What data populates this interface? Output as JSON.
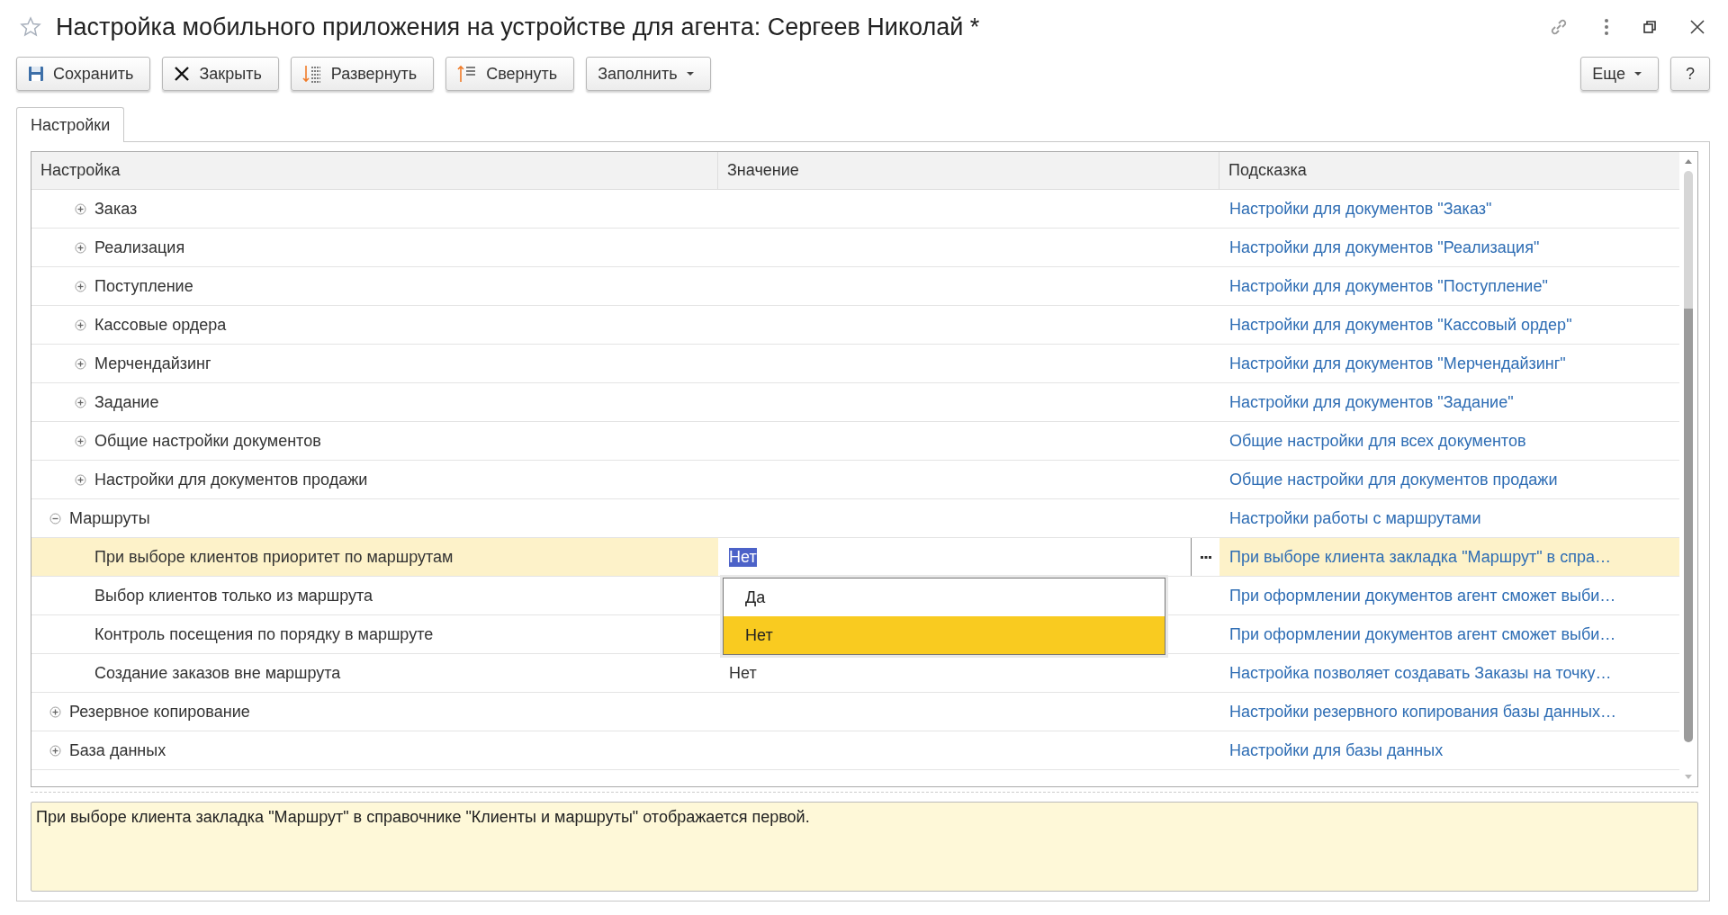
{
  "window": {
    "title": "Настройка мобильного приложения на устройстве для агента: Сергеев Николай *"
  },
  "toolbar": {
    "buttons": [
      {
        "label": "Сохранить",
        "kind": "save"
      },
      {
        "label": "Закрыть",
        "kind": "close"
      },
      {
        "label": "Развернуть",
        "kind": "expand"
      },
      {
        "label": "Свернуть",
        "kind": "collapse"
      },
      {
        "label": "Заполнить",
        "kind": "menu"
      }
    ],
    "right_buttons": [
      {
        "label": "Еще",
        "kind": "menu"
      },
      {
        "label": "?",
        "kind": "plain"
      }
    ]
  },
  "tabs": [
    {
      "label": "Настройки",
      "selected": true
    }
  ],
  "table": {
    "columns": [
      "Настройка",
      "Значение",
      "Подсказка"
    ],
    "rows": [
      {
        "children": [
          {
            "label": "Заказ",
            "expanded": false,
            "selected": false,
            "hint": "Настройки для документов \"Заказ\""
          },
          {
            "label": "Реализация",
            "expanded": false,
            "selected": false,
            "hint": "Настройки для документов \"Реализация\""
          },
          {
            "label": "Поступление",
            "expanded": false,
            "selected": false,
            "hint": "Настройки для документов \"Поступление\""
          },
          {
            "label": "Кассовые ордера",
            "expanded": false,
            "selected": false,
            "hint": "Настройки для документов \"Кассовый ордер\""
          },
          {
            "label": "Мерчендайзинг",
            "expanded": false,
            "selected": false,
            "hint": "Настройки для документов \"Мерчендайзинг\""
          },
          {
            "label": "Задание",
            "expanded": false,
            "selected": false,
            "hint": "Настройки для документов \"Задание\""
          },
          {
            "label": "Общие настройки документов",
            "expanded": false,
            "selected": false,
            "hint": "Общие настройки для всех документов"
          },
          {
            "label": "Настройки для документов продажи",
            "expanded": false,
            "selected": false,
            "hint": "Общие настройки для документов продажи"
          }
        ]
      },
      {
        "label": "Маршруты",
        "expanded": true,
        "selected": false,
        "hint": "Настройки работы с маршрутами",
        "children": [
          {
            "label": "При выборе клиентов приоритет по маршрутам",
            "value": "Нет",
            "selected": true,
            "editing": true,
            "hint": "При выборе клиента закладка \"Маршрут\" в спра…",
            "options": [
              {
                "label": "Да",
                "selected": false
              },
              {
                "label": "Нет",
                "selected": true
              }
            ]
          },
          {
            "label": "Выбор клиентов только из маршрута",
            "selected": false,
            "hint": "При оформлении документов агент сможет выби…"
          },
          {
            "label": "Контроль посещения по порядку в маршруте",
            "selected": false,
            "hint": "При оформлении документов агент сможет выби…"
          },
          {
            "label": "Создание заказов вне маршрута",
            "value": "Нет",
            "selected": false,
            "hint": "Настройка позволяет создавать Заказы на точку…"
          }
        ]
      },
      {
        "label": "Резервное копирование",
        "expanded": false,
        "selected": false,
        "hint": "Настройки резервного копирования базы данных…"
      },
      {
        "label": "База данных",
        "expanded": false,
        "selected": false,
        "hint": "Настройки для базы данных"
      }
    ]
  },
  "hint_box": {
    "text": "При выборе клиента закладка \"Маршрут\" в справочнике \"Клиенты и маршруты\" отображается первой."
  }
}
